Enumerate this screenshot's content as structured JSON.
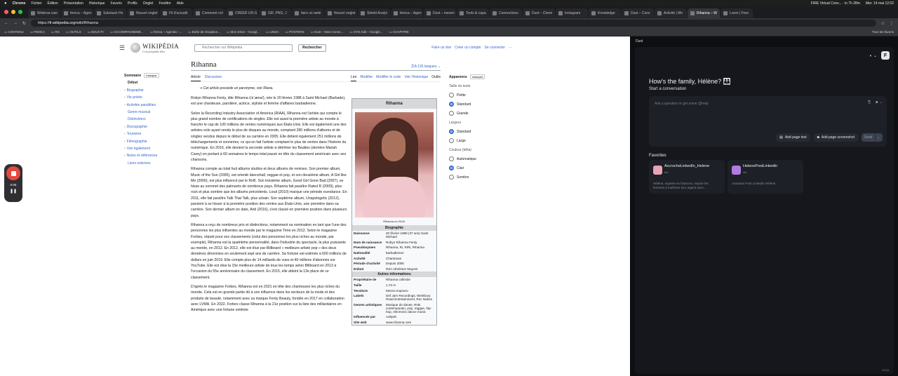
{
  "menubar": {
    "app": "Chrome",
    "items": [
      "Fichier",
      "Édition",
      "Présentation",
      "Historique",
      "Favoris",
      "Profils",
      "Onglet",
      "Fenêtre",
      "Aide"
    ],
    "right_event": "FIRE Virtual Conv... · in 7h 28m",
    "datetime": "Mer. 14 mai 12:02"
  },
  "tabs": [
    "Webinar.cam",
    "femca – Agen",
    "Substack Ho",
    "Nouvel onglet",
    "Fil d'actualit",
    "Comment cré",
    "CRÉER UN G",
    "GIF, PNG, J",
    "faire un webi",
    "Nouvel onglet",
    "Shield Analyt",
    "femca – Agen",
    "Dust – meven",
    "Tools & capa",
    "Connections",
    "Dust – Chem",
    "Instagram",
    "Knowledge",
    "Dust – Conv",
    "Activité | Mo",
    "Rihanna – W",
    "Loom | Free"
  ],
  "active_tab_index": 20,
  "address": {
    "url_prefix": "https://",
    "domain": "fr.wikipedia.org",
    "path": "/wiki/Rihanna"
  },
  "bookmarks": [
    "CONTENU",
    "FEMCA",
    "RS",
    "OUTILS",
    "EDUC'FI",
    "ACCOMPAGNEME...",
    "femca – Agenda –...",
    "Boîte de réception...",
    "Mon Drive – Googl...",
    "LINDA",
    "POSTERS",
    "Dust – New Conve...",
    "SYD Add – Google...",
    "CHAPITRE"
  ],
  "bookmarks_right": "Tous les favoris",
  "wiki": {
    "logo_name": "WIKIPÉDIA",
    "logo_tagline": "L'encyclopédie libre",
    "search_placeholder": "Rechercher sur Wikipédia",
    "search_button": "Rechercher",
    "top_links": [
      "Faire un don",
      "Créer un compte",
      "Se connecter"
    ],
    "toc_title": "Sommaire",
    "toc_hide": "masquer",
    "toc_items": [
      {
        "label": "Début",
        "current": true,
        "chev": false
      },
      {
        "label": "Biographie",
        "chev": true
      },
      {
        "label": "Vie privée",
        "chev": true
      },
      {
        "label": "Activités parallèles",
        "chev": true
      },
      {
        "label": "Genre musical",
        "chev": false
      },
      {
        "label": "Distinctions",
        "chev": false
      },
      {
        "label": "Discographie",
        "chev": true
      },
      {
        "label": "Tournées",
        "chev": true
      },
      {
        "label": "Filmographie",
        "chev": true
      },
      {
        "label": "Voir également",
        "chev": true
      },
      {
        "label": "Notes et références",
        "chev": true
      },
      {
        "label": "Liens externes",
        "chev": false
      }
    ],
    "title": "Rihanna",
    "languages": "135 langues",
    "tabs_left": [
      "Article",
      "Discussion"
    ],
    "tabs_right": [
      "Lire",
      "Modifier",
      "Modifier le code",
      "Voir l'historique",
      "Outils"
    ],
    "hatnote": "Cet article possède un paronyme, voir Riana.",
    "paragraphs": [
      "Robyn Rihanna Fenty, dite Rihanna (/ɹiˈænə/), née le 20 février 1988 à Saint Michael (Barbade), est une chanteuse, parolière, actrice, styliste et femme d'affaires barbadienne.",
      "Selon la Recording Industry Association of America (RIAA), Rihanna est l'artiste qui compte le plus grand nombre de certifications de singles. Elle est aussi la première artiste au monde à franchir le cap de 100 millions de ventes numériques aux États-Unis. Elle est également une des artistes solo ayant vendu le plus de disques au monde, comptant 280 millions d'albums et de singles vendus depuis le début de sa carrière en 2005. Elle détient également 251 millions de téléchargements et sonneries, ce qui en fait l'artiste comptant le plus de ventes dans l'histoire du numérique. En 2016, elle devient la seconde artiste à détrôner les Beatles (derrière Mariah Carey) en portant à 60 semaines le temps total passé en tête du classement américain avec ses chansons.",
      "Rihanna compte au total huit albums studios et deux albums de remixes. Son premier album, Music of the Sun (2005), est orienté dancehall, reggae et pop, et son deuxième album, A Girl like Me (2006), est plus influencé par le RnB. Son troisième album, Good Girl Gone Bad (2007), se hisse au sommet des palmarès de nombreux pays. Rihanna fait paraître Rated R (2009), plus rock et plus sombre que les albums précédents. Loud (2010) marque une période eurodance. En 2011, elle fait paraître Talk That Talk, plus urbain. Son septième album, Unapologetic (2012), parvient à se hisser à la première position des ventes aux États-Unis, une première dans sa carrière. Son dernier album en date, Anti (2016), s'est classé en première position dans plusieurs pays.",
      "Rihanna a reçu de nombreux prix et distinctions, notamment sa nomination en tant que l'une des personnes les plus influentes au monde par le magazine Time en 2012. Selon le magazine Forbes, réputé pour ses classements (celui des personnes les plus riches au monde, par exemple), Rihanna est la quatrième personnalité, dans l'industrie du spectacle, la plus puissante au monde, en 2012. En 2012, elle est élue par Billboard « meilleure artiste pop » des deux dernières décennies en seulement sept ans de carrière. Sa fortune est estimée à 600 millions de dollars en juin 2019. Elle compte plus de 14 milliards de vues et 40 millions d'abonnés sur YouTube. Elle est élue la 15e meilleure artiste de tous les temps selon Billboard en 2013 à l'occasion du 55e anniversaire du classement. En 2015, elle atteint la 13e place de ce classement.",
      "D'après le magazine Forbes, Rihanna est en 2021 en tête des chanteuses les plus riches du monde. Cela est en grande partie dû à son influence dans les secteurs de la mode et des produits de beauté, notamment avec sa marque Fenty Beauty, fondée en 2017 en collaboration avec LVMH. En 2022, Forbes classe Rihanna à la 21e position sur la liste des milliardaires en Amérique avec une fortune estimée"
    ],
    "infobox": {
      "title": "Rihanna",
      "caption": "Rihanna en 2018.",
      "section_bio": "Biographie",
      "bio_rows": [
        {
          "k": "Naissance",
          "v": "20 février 1988 (37 ans) Saint Michael"
        },
        {
          "k": "Nom de naissance",
          "v": "Robyn Rihanna Fenty"
        },
        {
          "k": "Pseudonymes",
          "v": "Rihanna, Ri, RiRi, Rihanna"
        },
        {
          "k": "Nationalité",
          "v": "barbadienne"
        },
        {
          "k": "Activité",
          "v": "Chanteuse"
        },
        {
          "k": "Période d'activité",
          "v": "Depuis 2005"
        },
        {
          "k": "Enfant",
          "v": "RZA Athelston Mayers"
        }
      ],
      "section_other": "Autres informations",
      "other_rows": [
        {
          "k": "Propriétaire de",
          "v": "Rihanna collectie"
        },
        {
          "k": "Taille",
          "v": "1,73 m"
        },
        {
          "k": "Tessiture",
          "v": "Mezzo-soprano"
        },
        {
          "k": "Labels",
          "v": "Def Jam Recordings, Westbury Road Entertainment, Roc Nation"
        },
        {
          "k": "Genres artistiques",
          "v": "Musique de danse, RnB contemporain, pop, reggae, hip-hop, electronic dance music"
        },
        {
          "k": "Influencée par",
          "v": "Aaliyah"
        },
        {
          "k": "Site web",
          "v": "www.rihanna.com"
        }
      ]
    },
    "appearance": {
      "title": "Apparence",
      "hide": "masquer",
      "text_size_label": "Taille du texte",
      "text_sizes": [
        {
          "label": "Petite",
          "on": false
        },
        {
          "label": "Standard",
          "on": true
        },
        {
          "label": "Grande",
          "on": false
        }
      ],
      "width_label": "Largeur",
      "widths": [
        {
          "label": "Standard",
          "on": true
        },
        {
          "label": "Large",
          "on": false
        }
      ],
      "color_label": "Couleur (bêta)",
      "colors": [
        {
          "label": "Automatique",
          "on": false
        },
        {
          "label": "Clair",
          "on": true
        },
        {
          "label": "Sombre",
          "on": false
        }
      ]
    }
  },
  "recorder": {
    "time": "0:05"
  },
  "dust": {
    "panel_title": "Dust",
    "avatar_letter": "F",
    "greeting": "How's the family, Hélène? 👪",
    "start": "Start a conversation",
    "input_placeholder": "Ask a question or get some @help",
    "add_page_text": "Add page text",
    "add_screenshot": "Add page screenshot",
    "send_label": "Send",
    "favorites_title": "Favorites",
    "favorites": [
      {
        "name": "AccrocheLinkedIn_Helene",
        "sub": "Me",
        "desc": "Hélène, experte en finances, inspire les femmes à maîtriser leur argent avec...",
        "color": "#e8a3b5"
      },
      {
        "name": "HelenePostLinkedIn",
        "sub": "Me",
        "desc": "Assistant Post LinkedIn Hélène",
        "color": "#b27be0"
      }
    ],
    "footer": "GCAL"
  }
}
